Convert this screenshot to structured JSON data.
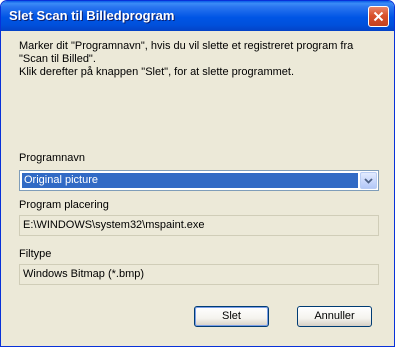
{
  "window": {
    "title": "Slet Scan til Billedprogram"
  },
  "instructions": {
    "line1": "Marker dit \"Programnavn\", hvis du vil slette et registreret  program fra",
    "line2": "\"Scan til Billed\".",
    "line3": "Klik derefter på knappen \"Slet\", for at slette programmet."
  },
  "program_name": {
    "label": "Programnavn",
    "selected_value": "Original picture"
  },
  "program_location": {
    "label": "Program placering",
    "value": "E:\\WINDOWS\\system32\\mspaint.exe"
  },
  "file_type": {
    "label": "Filtype",
    "value": "Windows Bitmap (*.bmp)"
  },
  "buttons": {
    "delete_label": "Slet",
    "cancel_label": "Annuller"
  },
  "icons": {
    "close": "close-icon",
    "dropdown": "chevron-down-icon"
  },
  "colors": {
    "titlebar": "#0055e5",
    "close_button": "#d9512c",
    "selection": "#316ac5",
    "dialog_background": "#ece9d8"
  }
}
